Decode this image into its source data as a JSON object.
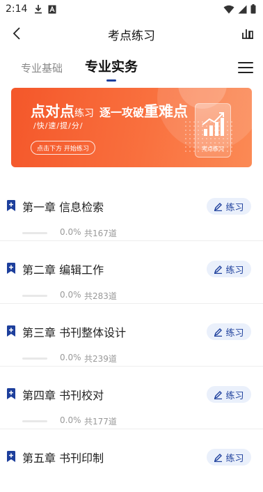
{
  "status_bar": {
    "time": "2:14"
  },
  "nav": {
    "title": "考点练习"
  },
  "tabs": [
    {
      "label": "专业基础",
      "active": false
    },
    {
      "label": "专业实务",
      "active": true
    }
  ],
  "banner": {
    "headline_a": "点对点",
    "headline_b": "练习",
    "headline_c": "逐一攻破",
    "headline_d": "重难点",
    "subtitle": "/快/速/提/分/",
    "button_label": "点击下方 开始练习",
    "card_label": "考点练习"
  },
  "chapters": [
    {
      "title": "第一章 信息检索",
      "progress_text": "0.0%",
      "progress": 0.0,
      "count": "共167道",
      "action": "练习"
    },
    {
      "title": "第二章 编辑工作",
      "progress_text": "0.0%",
      "progress": 0.0,
      "count": "共283道",
      "action": "练习"
    },
    {
      "title": "第三章 书刊整体设计",
      "progress_text": "0.0%",
      "progress": 0.0,
      "count": "共239道",
      "action": "练习"
    },
    {
      "title": "第四章 书刊校对",
      "progress_text": "0.0%",
      "progress": 0.0,
      "count": "共177道",
      "action": "练习"
    },
    {
      "title": "第五章 书刊印制",
      "progress_text": "",
      "progress": 0.0,
      "count": "",
      "action": "练习"
    }
  ],
  "colors": {
    "accent": "#1d3f9c",
    "banner_start": "#f4572a",
    "banner_end": "#fb8a55",
    "pill_bg": "#eaf0fb"
  },
  "icons": {
    "status": [
      "download-icon",
      "font-a-icon",
      "wifi-icon",
      "signal-icon",
      "battery-icon"
    ],
    "nav": [
      "back-icon",
      "bar-chart-icon"
    ],
    "tabs": [
      "menu-icon"
    ],
    "chapter": "bookmark-plus-icon",
    "action": "pencil-icon"
  }
}
